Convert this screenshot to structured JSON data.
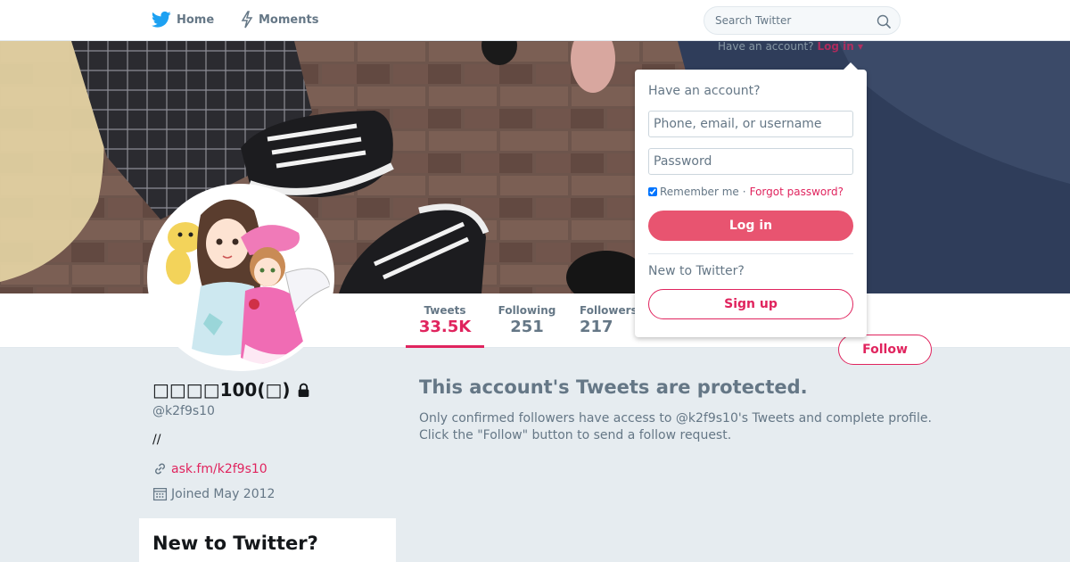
{
  "nav": {
    "home_label": "Home",
    "moments_label": "Moments",
    "search_placeholder": "Search Twitter"
  },
  "login_hint": {
    "prefix": "Have an account?",
    "link": "Log in ▾"
  },
  "login_dropdown": {
    "heading": "Have an account?",
    "username_placeholder": "Phone, email, or username",
    "password_placeholder": "Password",
    "remember_label": "Remember me",
    "separator": "·",
    "forgot_label": "Forgot password?",
    "login_button": "Log in",
    "new_heading": "New to Twitter?",
    "signup_button": "Sign up"
  },
  "stats": {
    "tweets_label": "Tweets",
    "tweets_value": "33.5K",
    "following_label": "Following",
    "following_value": "251",
    "followers_label": "Followers",
    "followers_value": "217"
  },
  "follow_button": "Follow",
  "profile": {
    "display_name": "□□□□100(□)",
    "handle": "@k2f9s10",
    "bio": "//",
    "url": "ask.fm/k2f9s10",
    "joined": "Joined May 2012"
  },
  "protected": {
    "title": "This account's Tweets are protected.",
    "line1": "Only confirmed followers have access to @k2f9s10's Tweets and complete profile.",
    "line2": "Click the \"Follow\" button to send a follow request."
  },
  "signup_card": {
    "title": "New to Twitter?"
  },
  "colors": {
    "accent": "#e0245e",
    "login_button_bg": "#e85470",
    "page_bg": "#e6ecf0",
    "twitter_blue": "#1da1f2"
  }
}
